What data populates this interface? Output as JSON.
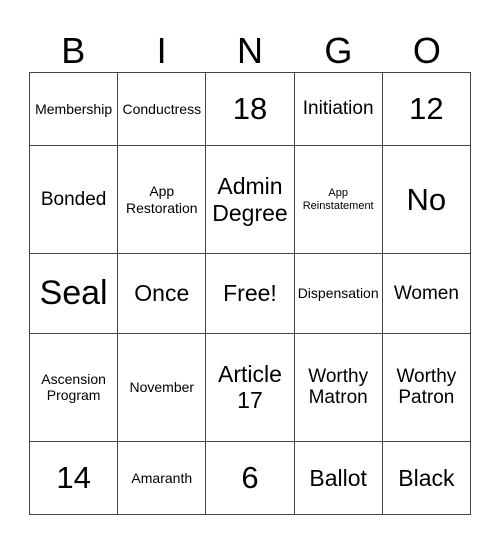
{
  "header": [
    "B",
    "I",
    "N",
    "G",
    "O"
  ],
  "rows": [
    [
      {
        "text": "Membership",
        "size": "s-sm"
      },
      {
        "text": "Conductress",
        "size": "s-sm"
      },
      {
        "text": "18",
        "size": "s-xl"
      },
      {
        "text": "Initiation",
        "size": "s-md"
      },
      {
        "text": "12",
        "size": "s-xl"
      }
    ],
    [
      {
        "text": "Bonded",
        "size": "s-md"
      },
      {
        "text": "App Restoration",
        "size": "s-sm"
      },
      {
        "text": "Admin Degree",
        "size": "s-lg"
      },
      {
        "text": "App Reinstatement",
        "size": "s-xs"
      },
      {
        "text": "No",
        "size": "s-xl"
      }
    ],
    [
      {
        "text": "Seal",
        "size": "s-xxl"
      },
      {
        "text": "Once",
        "size": "s-lg"
      },
      {
        "text": "Free!",
        "size": "s-lg"
      },
      {
        "text": "Dispensation",
        "size": "s-sm"
      },
      {
        "text": "Women",
        "size": "s-md"
      }
    ],
    [
      {
        "text": "Ascension Program",
        "size": "s-sm"
      },
      {
        "text": "November",
        "size": "s-sm"
      },
      {
        "text": "Article 17",
        "size": "s-lg"
      },
      {
        "text": "Worthy Matron",
        "size": "s-md"
      },
      {
        "text": "Worthy Patron",
        "size": "s-md"
      }
    ],
    [
      {
        "text": "14",
        "size": "s-xl"
      },
      {
        "text": "Amaranth",
        "size": "s-sm"
      },
      {
        "text": "6",
        "size": "s-xl"
      },
      {
        "text": "Ballot",
        "size": "s-lg"
      },
      {
        "text": "Black",
        "size": "s-lg"
      }
    ]
  ]
}
